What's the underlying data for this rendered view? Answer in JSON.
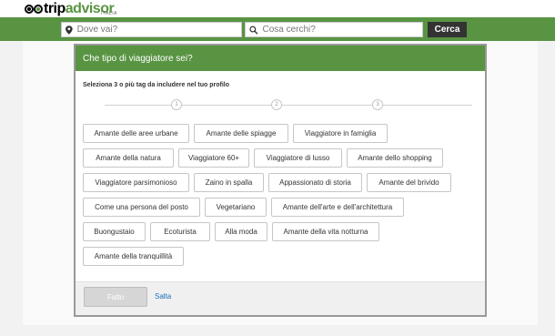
{
  "brand": {
    "name_part1": "trip",
    "name_part2": "advisor",
    "region": "ITALIA",
    "colors": {
      "green": "#589442",
      "dark": "#333333"
    }
  },
  "search": {
    "where_placeholder": "Dove vai?",
    "what_placeholder": "Cosa cerchi?",
    "submit_label": "Cerca"
  },
  "modal": {
    "title": "Che tipo di viaggiatore sei?",
    "subtitle": "Seleziona 3 o più tag da includere nel tuo profilo",
    "steps": [
      "1",
      "2",
      "3"
    ],
    "tags": [
      "Amante delle aree urbane",
      "Amante delle spiagge",
      "Viaggiatore in famiglia",
      "Amante della natura",
      "Viaggiatore 60+",
      "Viaggiatore di lusso",
      "Amante dello shopping",
      "Viaggiatore parsimonioso",
      "Zaino in spalla",
      "Appassionato di storia",
      "Amante del brivido",
      "Come una persona del posto",
      "Vegetariano",
      "Amante dell'arte e dell'architettura",
      "Buongustaio",
      "Ecoturista",
      "Alla moda",
      "Amante della vita notturna",
      "Amante della tranquillità"
    ],
    "done_label": "Fatto",
    "skip_label": "Salta"
  }
}
